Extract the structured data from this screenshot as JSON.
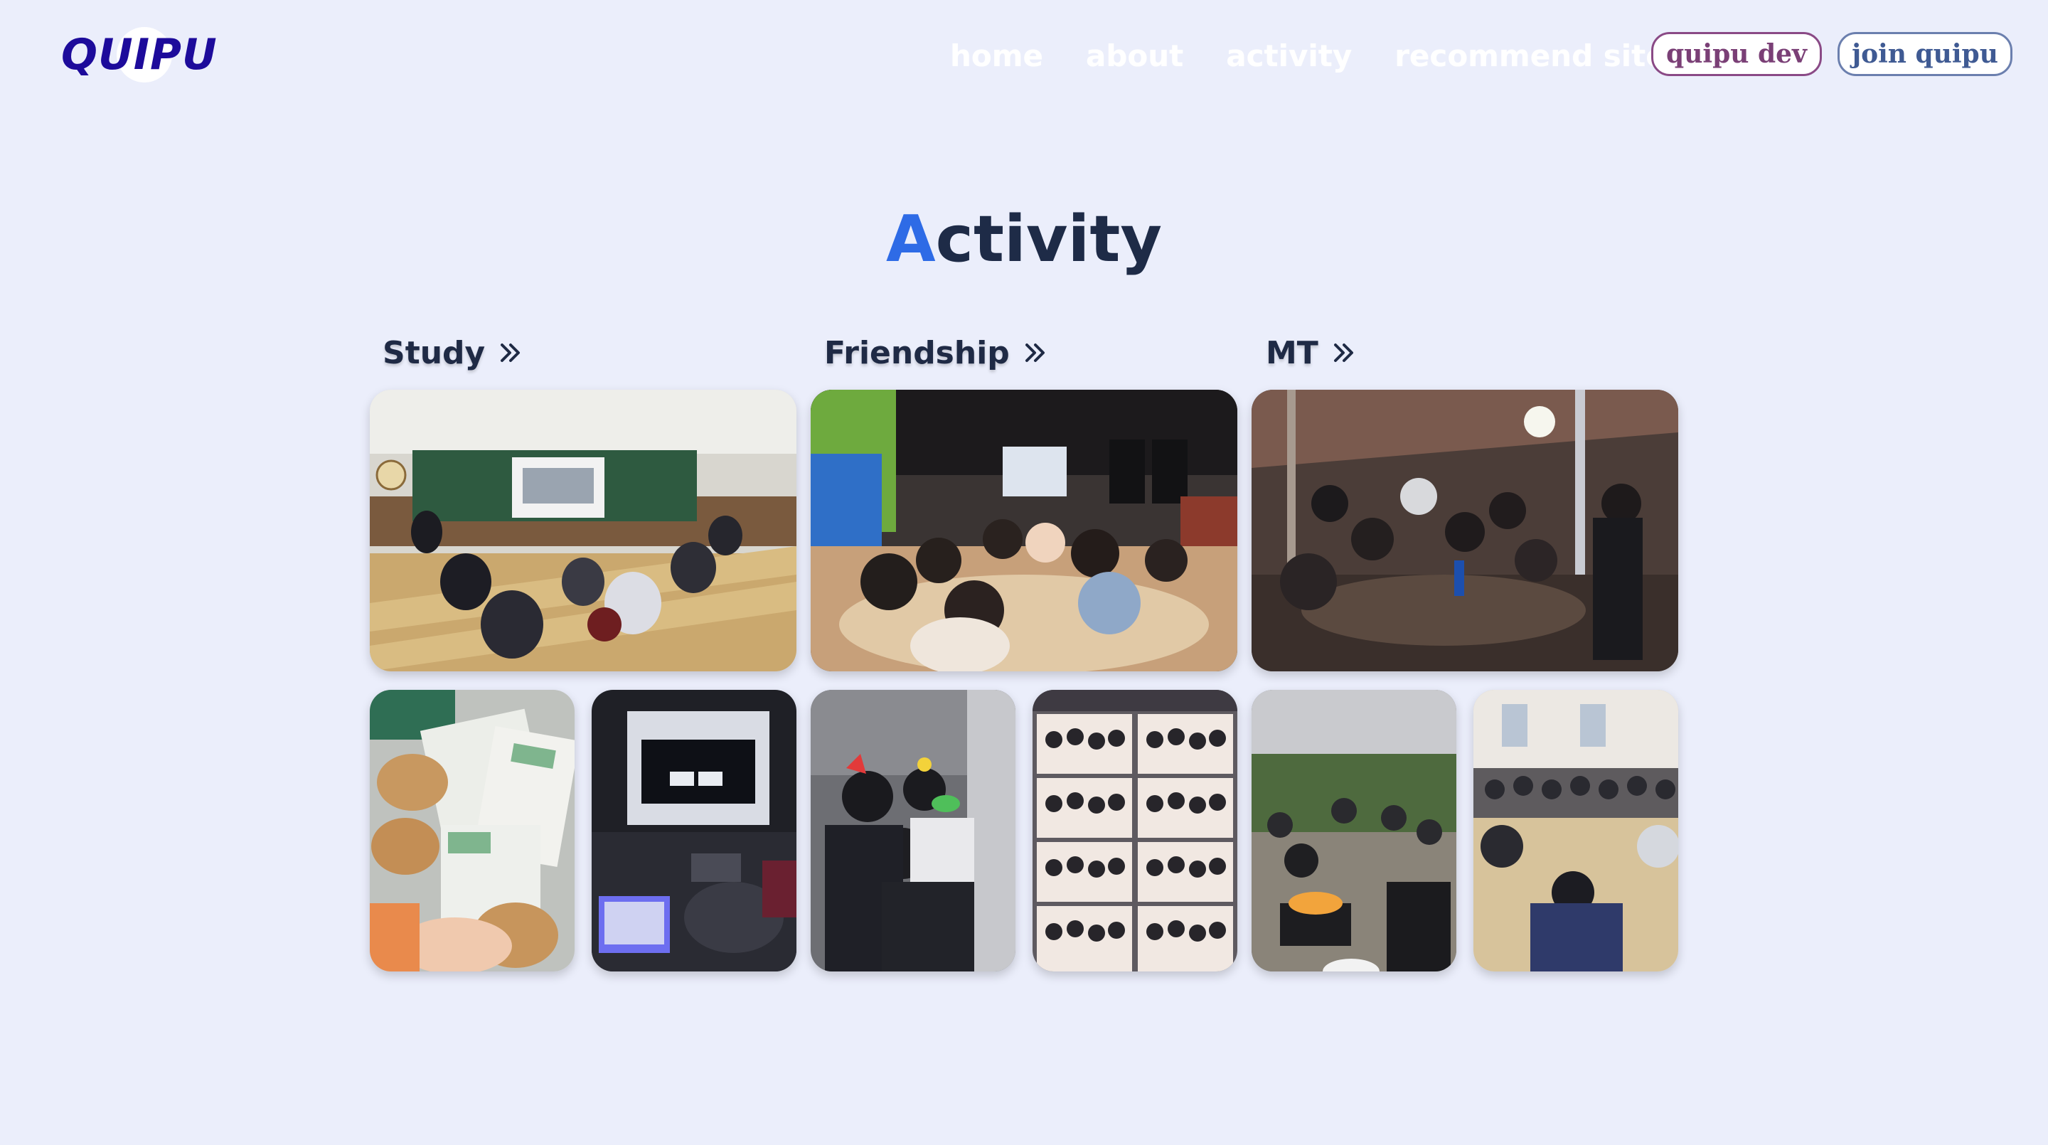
{
  "header": {
    "logo_text": "QUIPU",
    "nav": [
      "home",
      "about",
      "activity",
      "recommend site"
    ],
    "btn_dev": "quipu dev",
    "btn_join": "join quipu"
  },
  "title": {
    "accent": "A",
    "rest": "ctivity"
  },
  "categories": [
    {
      "label": "Study",
      "icon": "double-chevron-right-icon"
    },
    {
      "label": "Friendship",
      "icon": "double-chevron-right-icon"
    },
    {
      "label": "MT",
      "icon": "double-chevron-right-icon"
    }
  ],
  "photos": {
    "study_main": "classroom study session",
    "study_small_1": "name tags with bread",
    "study_small_2": "laptop presentation in dark room",
    "friendship_main": "group dinner at restaurant",
    "friendship_small_1": "three friends posing",
    "friendship_small_2": "photo booth strip grid",
    "mt_main": "group gathering under tent",
    "mt_small_1": "outdoor barbecue",
    "mt_small_2": "group seated on floor"
  },
  "colors": {
    "background": "#ebeefb",
    "logo": "#1d0b9b",
    "title_accent": "#2e6be6",
    "title": "#1e2b47",
    "dev_border": "#8a4a86",
    "join_border": "#6b7fae"
  }
}
